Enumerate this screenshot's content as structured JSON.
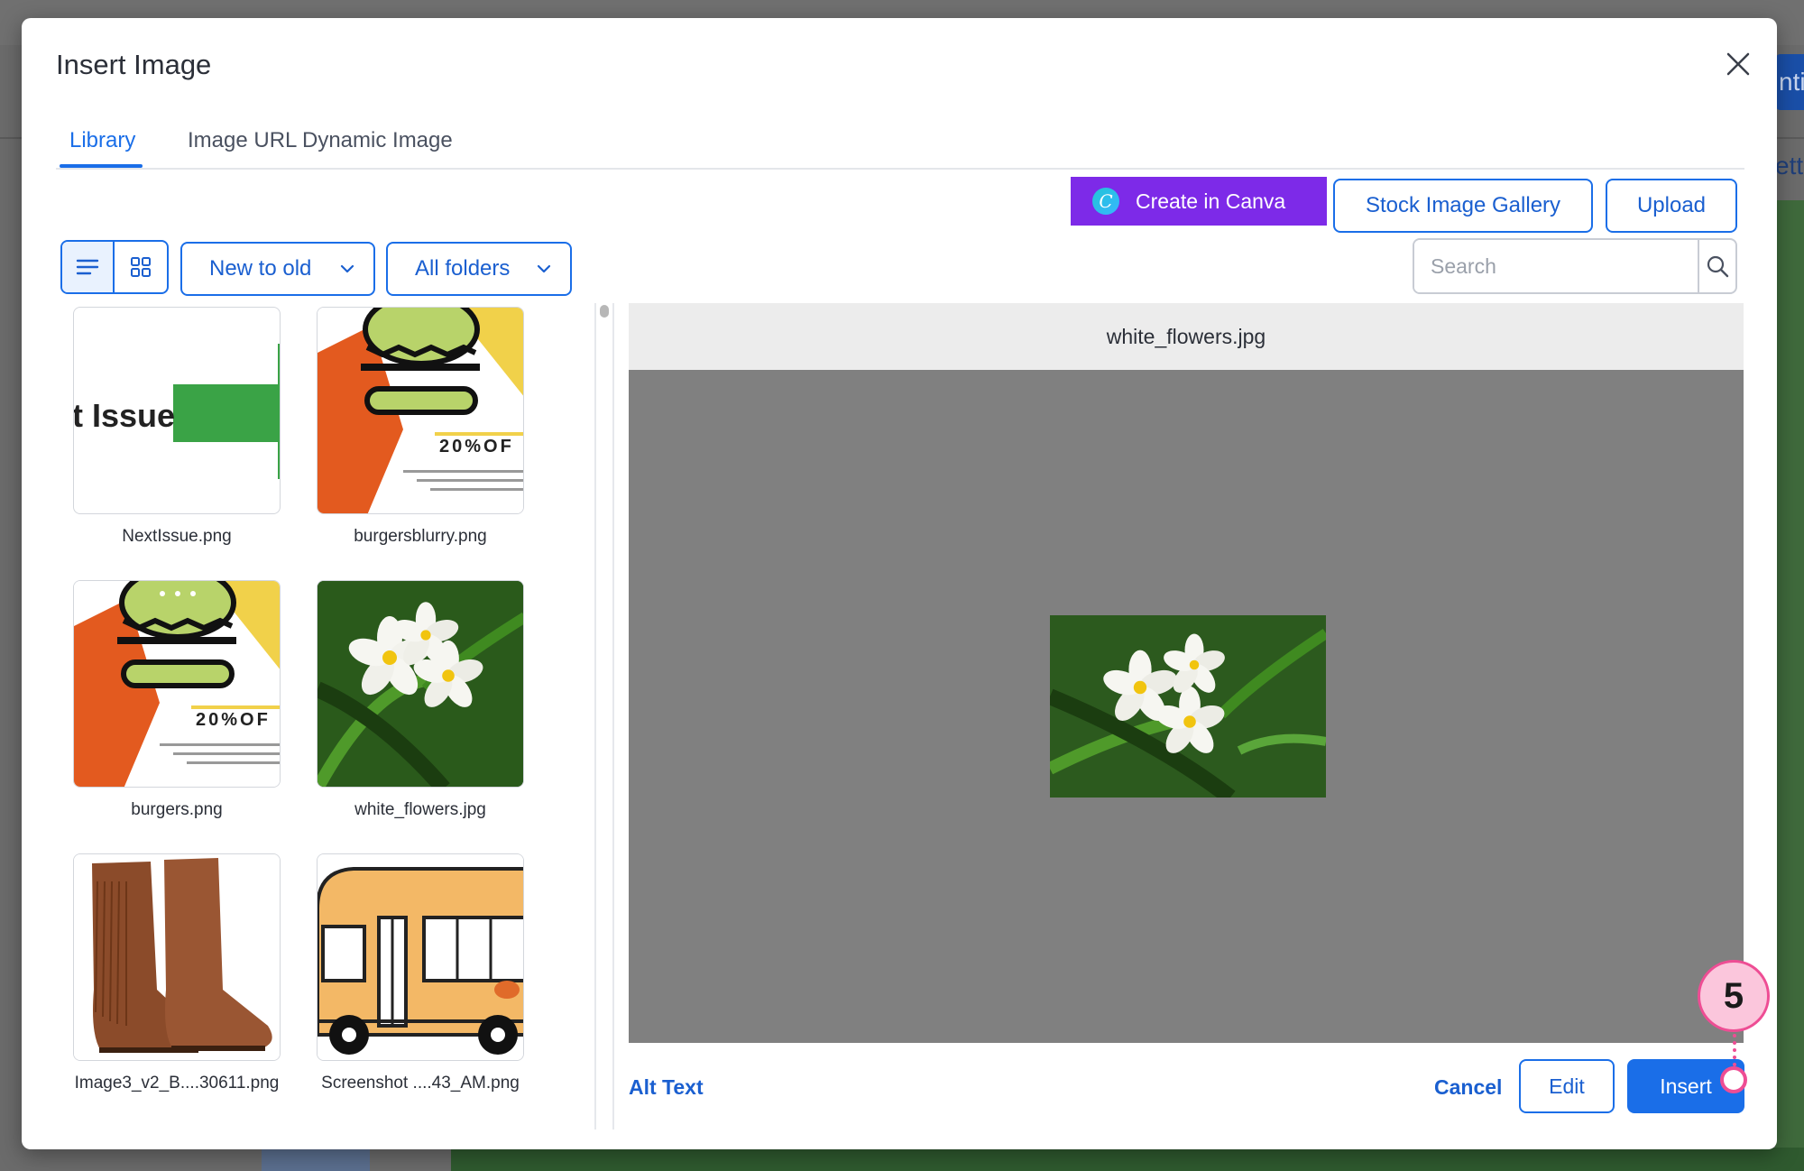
{
  "dialog": {
    "title": "Insert Image",
    "close_icon": "close-icon"
  },
  "tabs": [
    {
      "label": "Library",
      "active": true
    },
    {
      "label": "Image URL",
      "active": false
    },
    {
      "label": "Dynamic Image",
      "active": false
    }
  ],
  "actions": {
    "canva_label": "Create in Canva",
    "canva_logo_letter": "C",
    "stock_label": "Stock Image Gallery",
    "upload_label": "Upload"
  },
  "toolbar": {
    "view_list_icon": "list-view-icon",
    "view_grid_icon": "grid-view-icon",
    "sort_value": "New to old",
    "folder_value": "All folders",
    "search_placeholder": "Search"
  },
  "library": {
    "items": [
      {
        "name": "NextIssue.png",
        "thumb_text": "t Issue",
        "icon": "next-issue-thumbnail"
      },
      {
        "name": "burgersblurry.png",
        "thumb_text": "20%OF",
        "icon": "burger-thumbnail"
      },
      {
        "name": "burgers.png",
        "thumb_text": "20%OF",
        "icon": "burger-thumbnail"
      },
      {
        "name": "white_flowers.jpg",
        "icon": "flower-thumbnail",
        "selected": true
      },
      {
        "name": "Image3_v2_B....30611.png",
        "icon": "boots-thumbnail"
      },
      {
        "name": "Screenshot ....43_AM.png",
        "icon": "bus-thumbnail"
      }
    ]
  },
  "preview": {
    "filename": "white_flowers.jpg"
  },
  "footer": {
    "alt_text_label": "Alt Text",
    "cancel_label": "Cancel",
    "edit_label": "Edit",
    "insert_label": "Insert"
  },
  "callout": {
    "step": "5"
  },
  "colors": {
    "accent": "#1a6ee8",
    "canva": "#7d2ae8",
    "callout": "#ee4d94"
  }
}
